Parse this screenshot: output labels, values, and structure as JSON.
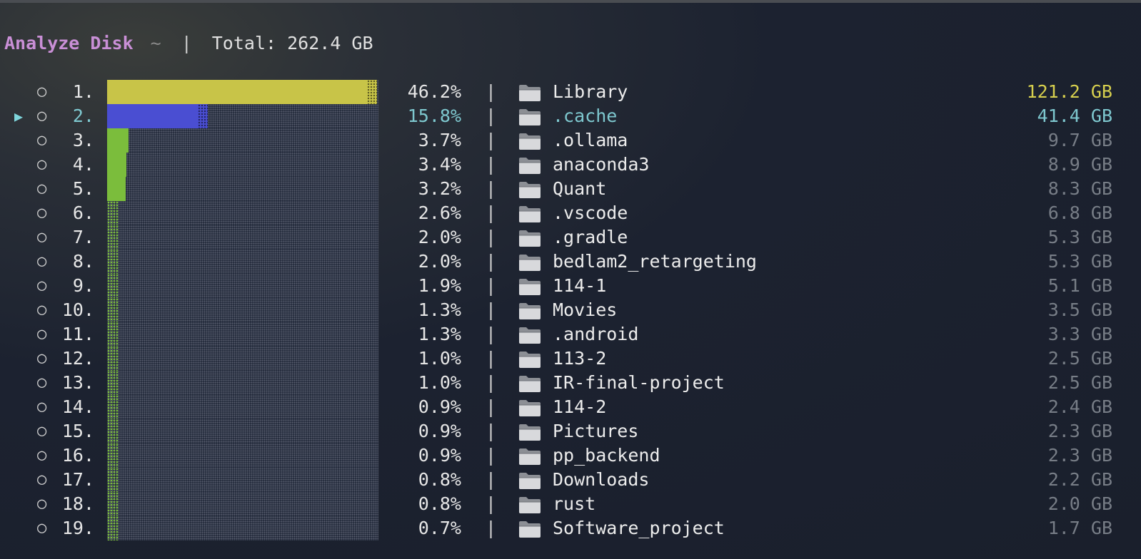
{
  "header": {
    "title": "Analyze Disk",
    "path": "~",
    "separator": "|",
    "total": "Total: 262.4 GB"
  },
  "selection": {
    "caret": "▶",
    "selected_index": 1
  },
  "colors": {
    "bar_top": "#c8c448",
    "bar_selected": "#4a4ed2",
    "bar_small": "#7bbd3c",
    "selected_text": "#7ec8cf",
    "top_size": "#d6cf4e",
    "title": "#c98fd6"
  },
  "rows": [
    {
      "index": "1.",
      "percent": "46.2%",
      "percent_value": 46.2,
      "name": "Library",
      "size": "121.2 GB",
      "icon": "folder-icon"
    },
    {
      "index": "2.",
      "percent": "15.8%",
      "percent_value": 15.8,
      "name": ".cache",
      "size": "41.4 GB",
      "icon": "folder-icon"
    },
    {
      "index": "3.",
      "percent": "3.7%",
      "percent_value": 3.7,
      "name": ".ollama",
      "size": "9.7 GB",
      "icon": "folder-icon"
    },
    {
      "index": "4.",
      "percent": "3.4%",
      "percent_value": 3.4,
      "name": "anaconda3",
      "size": "8.9 GB",
      "icon": "folder-icon"
    },
    {
      "index": "5.",
      "percent": "3.2%",
      "percent_value": 3.2,
      "name": "Quant",
      "size": "8.3 GB",
      "icon": "folder-icon"
    },
    {
      "index": "6.",
      "percent": "2.6%",
      "percent_value": 2.6,
      "name": ".vscode",
      "size": "6.8 GB",
      "icon": "folder-icon"
    },
    {
      "index": "7.",
      "percent": "2.0%",
      "percent_value": 2.0,
      "name": ".gradle",
      "size": "5.3 GB",
      "icon": "folder-icon"
    },
    {
      "index": "8.",
      "percent": "2.0%",
      "percent_value": 2.0,
      "name": "bedlam2_retargeting",
      "size": "5.3 GB",
      "icon": "folder-icon"
    },
    {
      "index": "9.",
      "percent": "1.9%",
      "percent_value": 1.9,
      "name": "114-1",
      "size": "5.1 GB",
      "icon": "folder-icon"
    },
    {
      "index": "10.",
      "percent": "1.3%",
      "percent_value": 1.3,
      "name": "Movies",
      "size": "3.5 GB",
      "icon": "folder-icon"
    },
    {
      "index": "11.",
      "percent": "1.3%",
      "percent_value": 1.3,
      "name": ".android",
      "size": "3.3 GB",
      "icon": "folder-icon"
    },
    {
      "index": "12.",
      "percent": "1.0%",
      "percent_value": 1.0,
      "name": "113-2",
      "size": "2.5 GB",
      "icon": "folder-icon"
    },
    {
      "index": "13.",
      "percent": "1.0%",
      "percent_value": 1.0,
      "name": "IR-final-project",
      "size": "2.5 GB",
      "icon": "folder-icon"
    },
    {
      "index": "14.",
      "percent": "0.9%",
      "percent_value": 0.9,
      "name": "114-2",
      "size": "2.4 GB",
      "icon": "folder-icon"
    },
    {
      "index": "15.",
      "percent": "0.9%",
      "percent_value": 0.9,
      "name": "Pictures",
      "size": "2.3 GB",
      "icon": "folder-icon"
    },
    {
      "index": "16.",
      "percent": "0.9%",
      "percent_value": 0.9,
      "name": "pp_backend",
      "size": "2.3 GB",
      "icon": "folder-icon"
    },
    {
      "index": "17.",
      "percent": "0.8%",
      "percent_value": 0.8,
      "name": "Downloads",
      "size": "2.2 GB",
      "icon": "folder-icon"
    },
    {
      "index": "18.",
      "percent": "0.8%",
      "percent_value": 0.8,
      "name": "rust",
      "size": "2.0 GB",
      "icon": "folder-icon"
    },
    {
      "index": "19.",
      "percent": "0.7%",
      "percent_value": 0.7,
      "name": "Software_project",
      "size": "1.7 GB",
      "icon": "folder-icon"
    }
  ]
}
